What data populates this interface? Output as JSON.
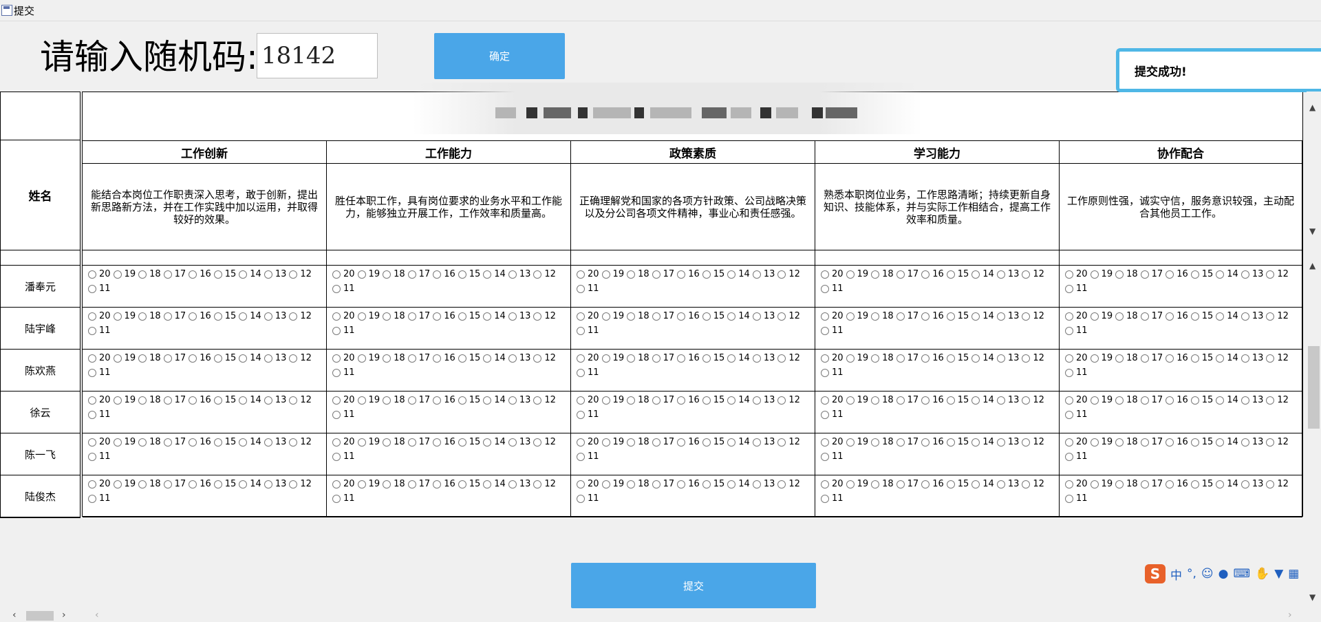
{
  "window": {
    "title": "提交"
  },
  "code": {
    "label": "请输入随机码:",
    "value": "18142"
  },
  "confirm_label": "确定",
  "toast": "提交成功!",
  "submit_label": "提交",
  "name_header": "姓名",
  "columns": [
    {
      "title": "工作创新",
      "desc": "能结合本岗位工作职责深入思考，敢于创新，提出新思路新方法，并在工作实践中加以运用，并取得较好的效果。"
    },
    {
      "title": "工作能力",
      "desc": "胜任本职工作，具有岗位要求的业务水平和工作能力，能够独立开展工作，工作效率和质量高。"
    },
    {
      "title": "政策素质",
      "desc": "正确理解党和国家的各项方针政策、公司战略决策以及分公司各项文件精神，事业心和责任感强。"
    },
    {
      "title": "学习能力",
      "desc": "熟悉本职岗位业务，工作思路清晰；持续更新自身知识、技能体系，并与实际工作相结合，提高工作效率和质量。"
    },
    {
      "title": "协作配合",
      "desc": "工作原则性强，诚实守信，服务意识较强，主动配合其他员工工作。"
    }
  ],
  "names": [
    "潘奉元",
    "陆宇峰",
    "陈欢燕",
    "徐云",
    "陈一飞",
    "陆俊杰"
  ],
  "score_options": [
    "20",
    "19",
    "18",
    "17",
    "16",
    "15",
    "14",
    "13",
    "12",
    "11"
  ],
  "ime": {
    "icons": [
      "sogou-logo-icon",
      "chinese-mode-icon",
      "punctuation-icon",
      "emoji-icon",
      "microphone-icon",
      "keyboard-icon",
      "hand-icon",
      "skin-icon",
      "toolbox-icon"
    ],
    "mode_label": "中"
  }
}
